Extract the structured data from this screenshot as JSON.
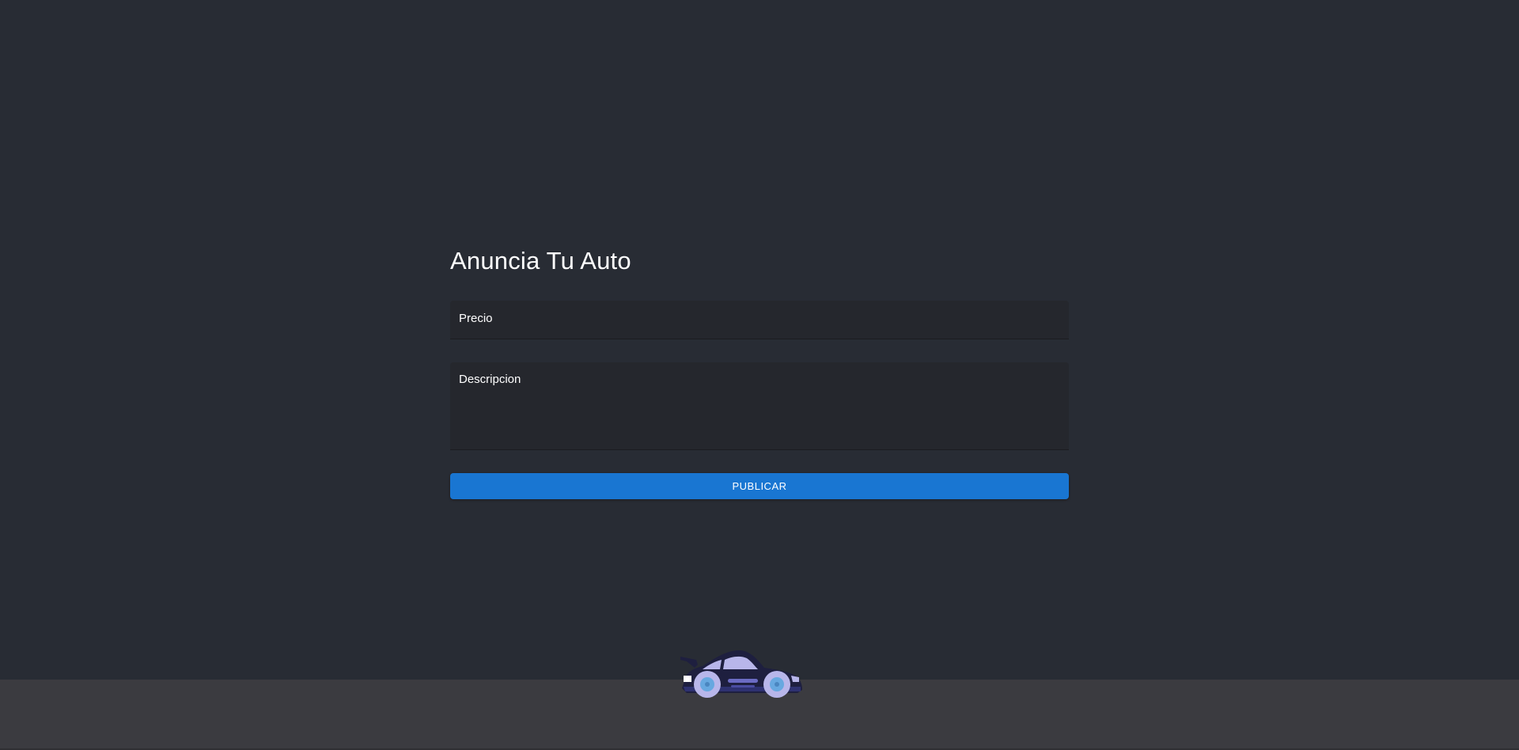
{
  "form": {
    "title": "Anuncia Tu Auto",
    "price_label": "Precio",
    "price_value": "",
    "description_label": "Descripcion",
    "description_value": "",
    "submit_label": "PUBLICAR"
  },
  "decor": {
    "car_icon": "race-car-icon"
  },
  "colors": {
    "background": "#282c34",
    "field_background": "#25272d",
    "accent": "#1976d2",
    "ground": "#3b3b40",
    "text": "#ffffff"
  }
}
